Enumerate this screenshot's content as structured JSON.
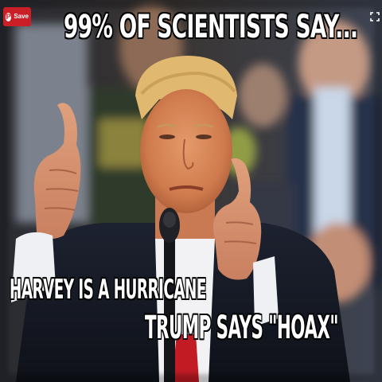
{
  "meme": {
    "top_caption": "99% OF SCIENTISTS SAY...",
    "bottom_line_1": "HARVEY IS A HURRICANE",
    "bottom_line_2": "TRUMP SAYS \"HOAX\""
  },
  "save_button": {
    "icon": "pinterest-icon",
    "label": "Save",
    "color": "#cb1f27"
  },
  "expand_button": {
    "icon": "expand-icon"
  }
}
